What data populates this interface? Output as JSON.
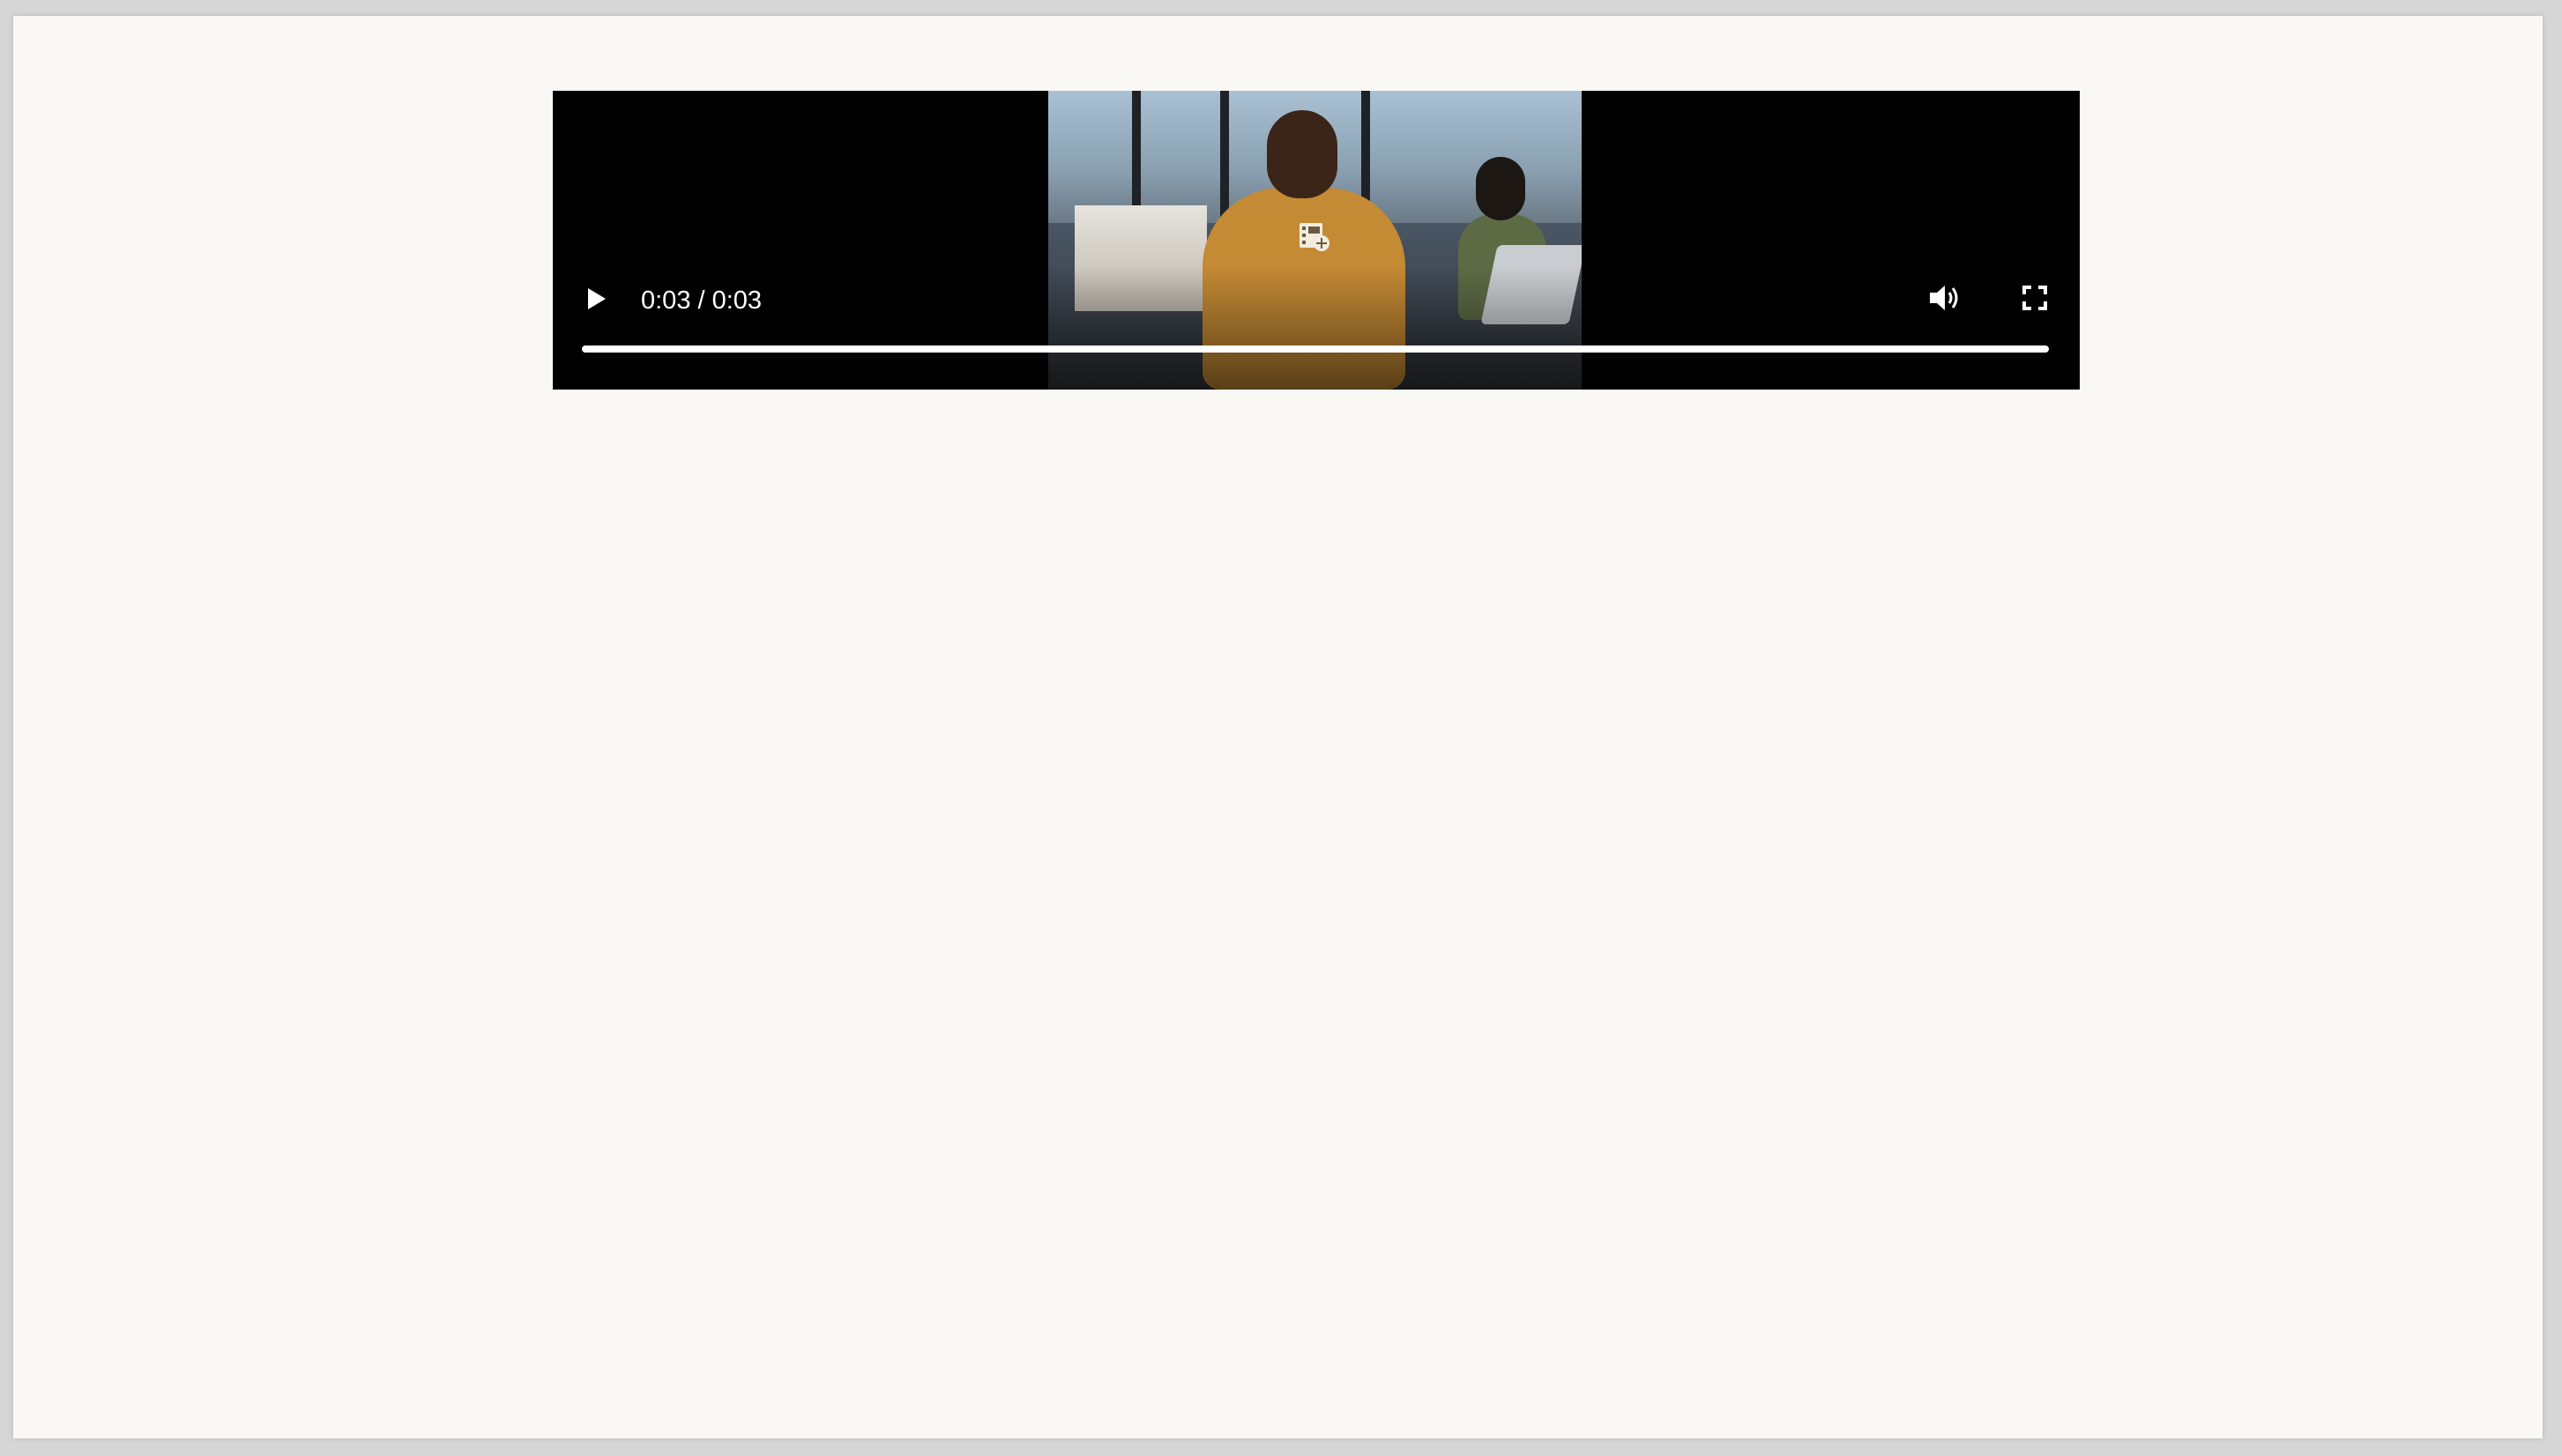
{
  "video_player": {
    "time_display": "0:03 / 0:03",
    "progress_fraction": 1.0
  },
  "icons": {
    "play": "play-icon",
    "volume": "volume-icon",
    "fullscreen": "fullscreen-icon",
    "overlay": "video-add-icon"
  }
}
